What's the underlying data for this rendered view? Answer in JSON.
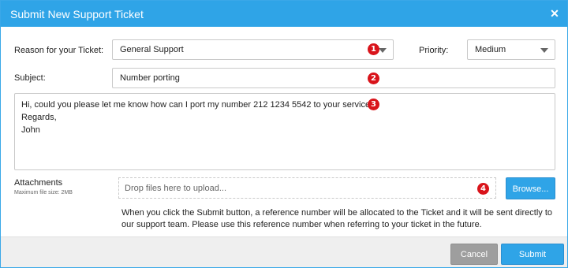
{
  "dialog": {
    "title": "Submit New Support Ticket",
    "close_icon": "close-icon"
  },
  "form": {
    "reason_label": "Reason for your Ticket:",
    "reason_value": "General Support",
    "priority_label": "Priority:",
    "priority_value": "Medium",
    "subject_label": "Subject:",
    "subject_value": "Number porting",
    "message_lines": [
      "Hi, could you please let me know how can I port my number 212 1234 5542 to your service?",
      "Regards,",
      "John"
    ],
    "attachments_label": "Attachments",
    "attachments_hint": "Maximum file size: 2MB",
    "dropzone_placeholder": "Drop files here to upload...",
    "browse_label": "Browse...",
    "note_text": "When you click the Submit button, a reference number will be allocated to the Ticket and it will be sent directly to our support team. Please use this reference number when referring to your ticket in the future."
  },
  "badges": [
    "1",
    "2",
    "3",
    "4"
  ],
  "footer": {
    "cancel_label": "Cancel",
    "submit_label": "Submit"
  },
  "colors": {
    "accent": "#2fa4e7",
    "badge": "#d9141b",
    "cancel": "#9e9e9e"
  }
}
